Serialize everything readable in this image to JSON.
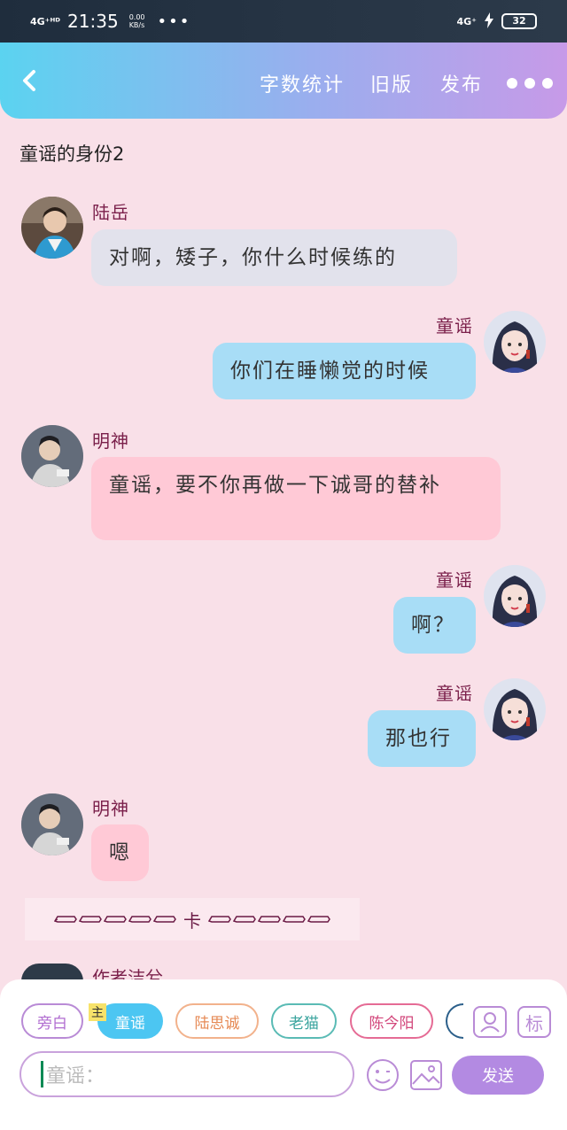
{
  "status_bar": {
    "network": "4G⁺ᴴᴰ",
    "time": "21:35",
    "speed": "0.00",
    "speed_unit": "KB/s",
    "more": "•••",
    "network_right": "4G⁺",
    "battery": "32"
  },
  "navbar": {
    "word_count": "字数统计",
    "old_version": "旧版",
    "publish": "发布"
  },
  "chapter_title": "童谣的身份2",
  "messages": [
    {
      "speaker": "陆岳",
      "text": "对啊，矮子，你什么时候练的"
    },
    {
      "speaker": "童谣",
      "text": "你们在睡懒觉的时候"
    },
    {
      "speaker": "明神",
      "text": "童谣，要不你再做一下诚哥的替补"
    },
    {
      "speaker": "童谣",
      "text": "啊？"
    },
    {
      "speaker": "童谣",
      "text": "那也行"
    },
    {
      "speaker": "明神",
      "text": "嗯"
    }
  ],
  "divider": {
    "center": "卡"
  },
  "partial_speaker": "作者洁兮",
  "characters": {
    "narration": "旁白",
    "main_tag": "主",
    "active": "童谣",
    "c3": "陆思诚",
    "c4": "老猫",
    "c5": "陈今阳"
  },
  "mark_label": "标",
  "input": {
    "prefix": "童谣："
  },
  "send_label": "发送",
  "colors": {
    "background": "#f9e0e8",
    "accent_blue": "#4cc6f2",
    "send_purple": "#b38ae2",
    "name_color": "#7a1f4a"
  }
}
